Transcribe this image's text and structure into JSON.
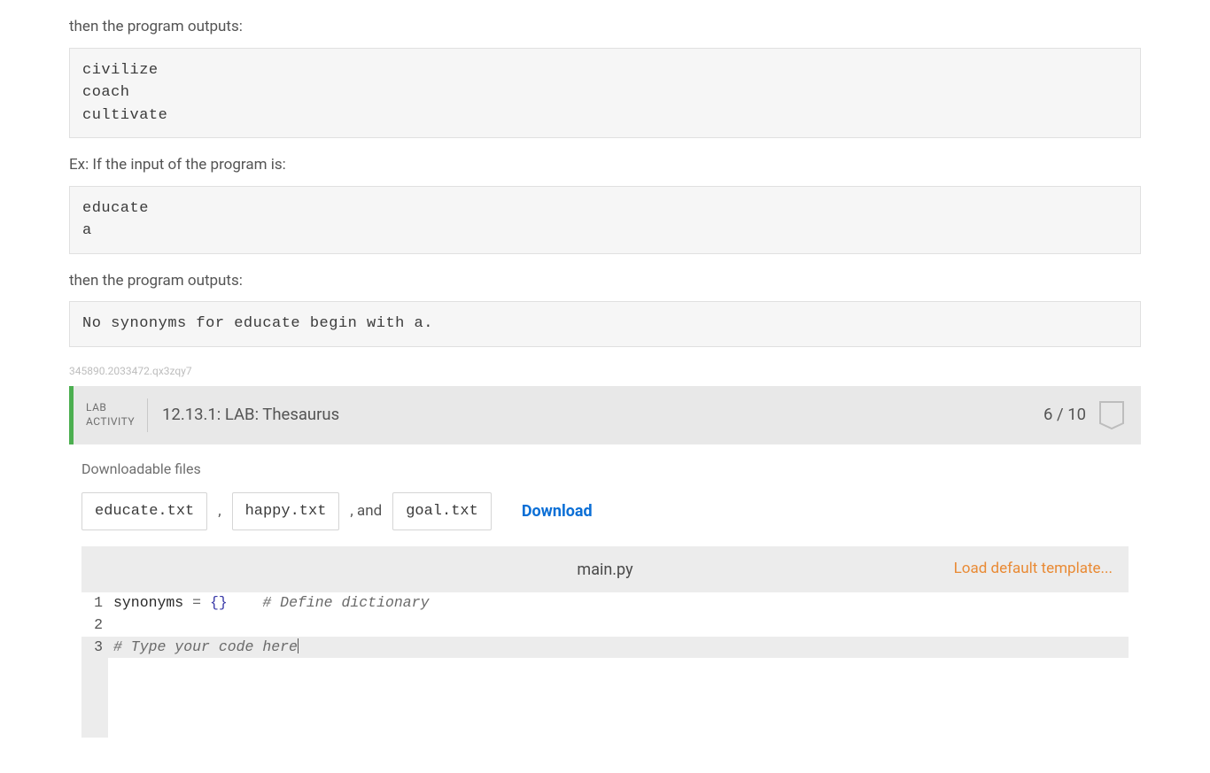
{
  "intro": {
    "output_phrase": "then the program outputs:",
    "output1": "civilize\ncoach\ncultivate",
    "ex_input_label": "Ex: If the input of the program is:",
    "input2": "educate\na",
    "output2": "No synonyms for educate begin with a."
  },
  "watermark": "345890.2033472.qx3zqy7",
  "lab": {
    "label_line1": "LAB",
    "label_line2": "ACTIVITY",
    "title": "12.13.1: LAB: Thesaurus",
    "score": "6 / 10"
  },
  "downloads": {
    "title": "Downloadable files",
    "files": [
      "educate.txt",
      "happy.txt",
      "goal.txt"
    ],
    "sep_comma": ",",
    "sep_and": ", and",
    "link": "Download"
  },
  "editor": {
    "filename": "main.py",
    "load_template": "Load default template...",
    "lines": [
      {
        "n": "1",
        "tokens": [
          {
            "t": "ident",
            "v": "synonyms "
          },
          {
            "t": "op",
            "v": "= "
          },
          {
            "t": "brace",
            "v": "{}"
          },
          {
            "t": "plain",
            "v": "    "
          },
          {
            "t": "comment",
            "v": "# Define dictionary"
          }
        ]
      },
      {
        "n": "2",
        "tokens": []
      },
      {
        "n": "3",
        "current": true,
        "tokens": [
          {
            "t": "comment",
            "v": "# Type your code here"
          },
          {
            "t": "cursor",
            "v": ""
          }
        ]
      }
    ]
  }
}
